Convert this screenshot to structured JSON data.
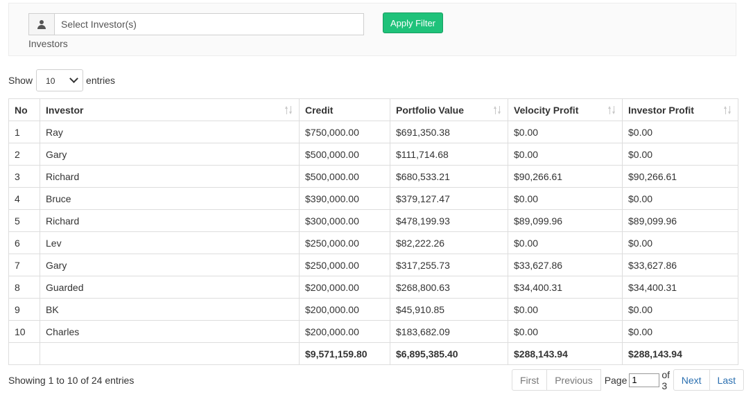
{
  "filter": {
    "placeholder": "Select Investor(s)",
    "label": "Investors",
    "apply_label": "Apply Filter",
    "user_icon": "user-icon"
  },
  "length": {
    "show": "Show",
    "value": "10",
    "entries": "entries"
  },
  "table": {
    "headers": [
      "No",
      "Investor",
      "Credit",
      "Portfolio Value",
      "Velocity Profit",
      "Investor Profit"
    ],
    "rows": [
      [
        "1",
        "Ray",
        "$750,000.00",
        "$691,350.38",
        "$0.00",
        "$0.00"
      ],
      [
        "2",
        "Gary",
        "$500,000.00",
        "$111,714.68",
        "$0.00",
        "$0.00"
      ],
      [
        "3",
        "Richard",
        "$500,000.00",
        "$680,533.21",
        "$90,266.61",
        "$90,266.61"
      ],
      [
        "4",
        "Bruce",
        "$390,000.00",
        "$379,127.47",
        "$0.00",
        "$0.00"
      ],
      [
        "5",
        "Richard",
        "$300,000.00",
        "$478,199.93",
        "$89,099.96",
        "$89,099.96"
      ],
      [
        "6",
        "Lev",
        "$250,000.00",
        "$82,222.26",
        "$0.00",
        "$0.00"
      ],
      [
        "7",
        "Gary",
        "$250,000.00",
        "$317,255.73",
        "$33,627.86",
        "$33,627.86"
      ],
      [
        "8",
        "Guarded",
        "$200,000.00",
        "$268,800.63",
        "$34,400.31",
        "$34,400.31"
      ],
      [
        "9",
        "BK",
        "$200,000.00",
        "$45,910.85",
        "$0.00",
        "$0.00"
      ],
      [
        "10",
        "Charles",
        "$200,000.00",
        "$183,682.09",
        "$0.00",
        "$0.00"
      ]
    ],
    "totals": [
      "",
      "",
      "$9,571,159.80",
      "$6,895,385.40",
      "$288,143.94",
      "$288,143.94"
    ]
  },
  "footer": {
    "info": "Showing 1 to 10 of 24 entries",
    "first": "First",
    "previous": "Previous",
    "page_label": "Page",
    "page_value": "1",
    "of_total": "of 3",
    "next": "Next",
    "last": "Last"
  }
}
